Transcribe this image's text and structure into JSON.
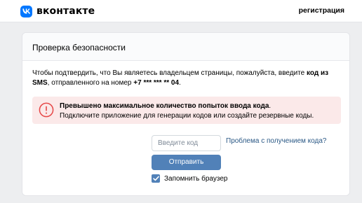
{
  "header": {
    "logo_text": "вконтакте",
    "register_link": "регистрация"
  },
  "card": {
    "title": "Проверка безопасности",
    "description": {
      "part1": "Чтобы подтвердить, что Вы являетесь владельцем страницы, пожалуйста, введите ",
      "bold1": "код из SMS",
      "part2": ", отправленного на номер ",
      "phone": "+7 *** *** ** 04",
      "part3": "."
    },
    "alert": {
      "title_bold": "Превышено максимальное количество попыток ввода кода",
      "title_end": ".",
      "text": "Подключите приложение для генерации кодов или создайте резервные коды."
    },
    "code_field": {
      "placeholder": "Введите код",
      "value": ""
    },
    "problem_link": "Проблема с получением кода?",
    "submit_label": "Отправить",
    "remember": {
      "label": "Запомнить браузер",
      "checked": true
    }
  },
  "colors": {
    "accent": "#5181b8",
    "brand": "#0077ff",
    "link": "#2a5885",
    "alert_bg": "#fbe9e9",
    "alert_icon": "#e64646",
    "page_bg": "#edeef0"
  },
  "icons": {
    "logo": "vk-logo-icon",
    "alert": "exclamation-circle-icon",
    "checkbox": "checkmark-icon"
  }
}
